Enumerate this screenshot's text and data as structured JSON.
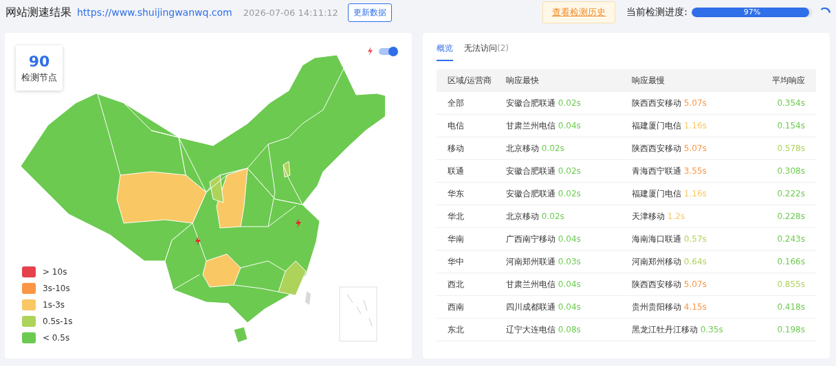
{
  "header": {
    "title": "网站测速结果",
    "url": "https://www.shuijingwanwq.com",
    "time": "2026-07-06 14:11:12",
    "refresh_button": "更新数据",
    "history_button": "查看检测历史",
    "progress_label": "当前检测进度:",
    "progress": {
      "level": 0.97,
      "reading": "97%"
    }
  },
  "map_panel": {
    "node_count": "90",
    "node_label": "检测节点",
    "toggle": {
      "on": true
    },
    "legend": [
      {
        "label": "> 10s",
        "color": "#e5424d"
      },
      {
        "label": "3s-10s",
        "color": "#fa9646"
      },
      {
        "label": "1s-3s",
        "color": "#f9c764"
      },
      {
        "label": "0.5s-1s",
        "color": "#aed35a"
      },
      {
        "label": "< 0.5s",
        "color": "#6cca50"
      }
    ]
  },
  "results": {
    "tabs": [
      {
        "label": "概览",
        "selected": true
      },
      {
        "label": "无法访问",
        "count": "(2)",
        "selected": false
      }
    ],
    "columns": [
      "区域/运营商",
      "响应最快",
      "响应最慢",
      "平均响应"
    ],
    "rows": [
      {
        "region": "全部",
        "fast": "安徽合肥联通",
        "fast_time": {
          "text": "0.02s",
          "color": "#6cca50"
        },
        "slow": "陕西西安移动",
        "slow_time": {
          "text": "5.07s",
          "color": "#fa9646"
        },
        "avg": {
          "text": "0.354s",
          "color": "#6cca50"
        }
      },
      {
        "region": "电信",
        "fast": "甘肃兰州电信",
        "fast_time": {
          "text": "0.04s",
          "color": "#6cca50"
        },
        "slow": "福建厦门电信",
        "slow_time": {
          "text": "1.16s",
          "color": "#f9c764"
        },
        "avg": {
          "text": "0.154s",
          "color": "#6cca50"
        }
      },
      {
        "region": "移动",
        "fast": "北京移动",
        "fast_time": {
          "text": "0.02s",
          "color": "#6cca50"
        },
        "slow": "陕西西安移动",
        "slow_time": {
          "text": "5.07s",
          "color": "#fa9646"
        },
        "avg": {
          "text": "0.578s",
          "color": "#aed35a"
        }
      },
      {
        "region": "联通",
        "fast": "安徽合肥联通",
        "fast_time": {
          "text": "0.02s",
          "color": "#6cca50"
        },
        "slow": "青海西宁联通",
        "slow_time": {
          "text": "3.55s",
          "color": "#fa9646"
        },
        "avg": {
          "text": "0.308s",
          "color": "#6cca50"
        }
      },
      {
        "region": "华东",
        "fast": "安徽合肥联通",
        "fast_time": {
          "text": "0.02s",
          "color": "#6cca50"
        },
        "slow": "福建厦门电信",
        "slow_time": {
          "text": "1.16s",
          "color": "#f9c764"
        },
        "avg": {
          "text": "0.222s",
          "color": "#6cca50"
        }
      },
      {
        "region": "华北",
        "fast": "北京移动",
        "fast_time": {
          "text": "0.02s",
          "color": "#6cca50"
        },
        "slow": "天津移动",
        "slow_time": {
          "text": "1.2s",
          "color": "#f9c764"
        },
        "avg": {
          "text": "0.228s",
          "color": "#6cca50"
        }
      },
      {
        "region": "华南",
        "fast": "广西南宁移动",
        "fast_time": {
          "text": "0.04s",
          "color": "#6cca50"
        },
        "slow": "海南海口联通",
        "slow_time": {
          "text": "0.57s",
          "color": "#aed35a"
        },
        "avg": {
          "text": "0.243s",
          "color": "#6cca50"
        }
      },
      {
        "region": "华中",
        "fast": "河南郑州联通",
        "fast_time": {
          "text": "0.03s",
          "color": "#6cca50"
        },
        "slow": "河南郑州移动",
        "slow_time": {
          "text": "0.64s",
          "color": "#aed35a"
        },
        "avg": {
          "text": "0.166s",
          "color": "#6cca50"
        }
      },
      {
        "region": "西北",
        "fast": "甘肃兰州电信",
        "fast_time": {
          "text": "0.04s",
          "color": "#6cca50"
        },
        "slow": "陕西西安移动",
        "slow_time": {
          "text": "5.07s",
          "color": "#fa9646"
        },
        "avg": {
          "text": "0.855s",
          "color": "#aed35a"
        }
      },
      {
        "region": "西南",
        "fast": "四川成都联通",
        "fast_time": {
          "text": "0.04s",
          "color": "#6cca50"
        },
        "slow": "贵州贵阳移动",
        "slow_time": {
          "text": "4.15s",
          "color": "#fa9646"
        },
        "avg": {
          "text": "0.418s",
          "color": "#6cca50"
        }
      },
      {
        "region": "东北",
        "fast": "辽宁大连电信",
        "fast_time": {
          "text": "0.08s",
          "color": "#6cca50"
        },
        "slow": "黑龙江牡丹江移动",
        "slow_time": {
          "text": "0.35s",
          "color": "#6cca50"
        },
        "avg": {
          "text": "0.198s",
          "color": "#6cca50"
        }
      }
    ]
  }
}
